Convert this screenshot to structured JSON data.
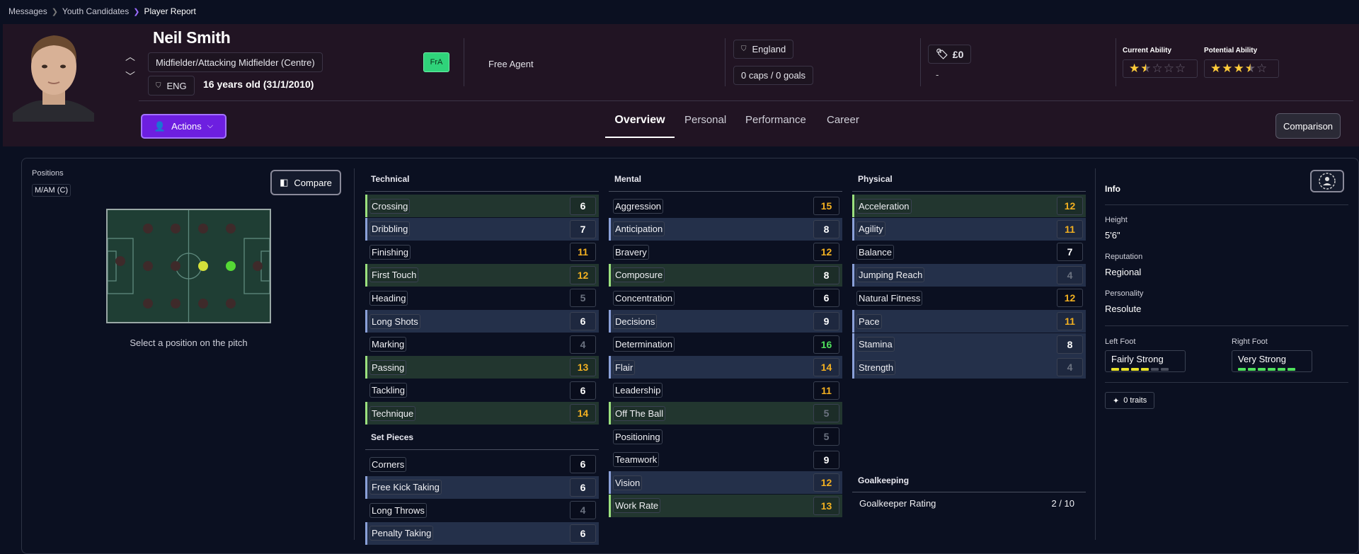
{
  "breadcrumb": {
    "items": [
      "Messages",
      "Youth Candidates",
      "Player Report"
    ]
  },
  "player": {
    "name": "Neil Smith",
    "role": "Midfielder/Attacking Midfielder (Centre)",
    "nation_code": "ENG",
    "age": "16 years old (31/1/2010)",
    "contract_badge": "FrA",
    "contract_status": "Free Agent",
    "nation": "England",
    "caps_goals": "0 caps / 0 goals",
    "value": "£0",
    "wage": "-",
    "current_ability_label": "Current Ability",
    "potential_ability_label": "Potential Ability",
    "current_ability_stars": 1.5,
    "potential_ability_stars": 3.5
  },
  "actions_label": "Actions",
  "tabs": [
    "Overview",
    "Personal",
    "Performance",
    "Career"
  ],
  "active_tab": "Overview",
  "comparison_label": "Comparison",
  "positions": {
    "label": "Positions",
    "tag": "M/AM (C)",
    "compare_label": "Compare",
    "hint": "Select a position on the pitch"
  },
  "technical": {
    "title": "Technical",
    "rows": [
      {
        "name": "Crossing",
        "value": "6"
      },
      {
        "name": "Dribbling",
        "value": "7"
      },
      {
        "name": "Finishing",
        "value": "11"
      },
      {
        "name": "First Touch",
        "value": "12"
      },
      {
        "name": "Heading",
        "value": "5"
      },
      {
        "name": "Long Shots",
        "value": "6"
      },
      {
        "name": "Marking",
        "value": "4"
      },
      {
        "name": "Passing",
        "value": "13"
      },
      {
        "name": "Tackling",
        "value": "6"
      },
      {
        "name": "Technique",
        "value": "14"
      }
    ]
  },
  "set_pieces": {
    "title": "Set Pieces",
    "rows": [
      {
        "name": "Corners",
        "value": "6"
      },
      {
        "name": "Free Kick Taking",
        "value": "6"
      },
      {
        "name": "Long Throws",
        "value": "4"
      },
      {
        "name": "Penalty Taking",
        "value": "6"
      }
    ]
  },
  "mental": {
    "title": "Mental",
    "rows": [
      {
        "name": "Aggression",
        "value": "15"
      },
      {
        "name": "Anticipation",
        "value": "8"
      },
      {
        "name": "Bravery",
        "value": "12"
      },
      {
        "name": "Composure",
        "value": "8"
      },
      {
        "name": "Concentration",
        "value": "6"
      },
      {
        "name": "Decisions",
        "value": "9"
      },
      {
        "name": "Determination",
        "value": "16"
      },
      {
        "name": "Flair",
        "value": "14"
      },
      {
        "name": "Leadership",
        "value": "11"
      },
      {
        "name": "Off The Ball",
        "value": "5"
      },
      {
        "name": "Positioning",
        "value": "5"
      },
      {
        "name": "Teamwork",
        "value": "9"
      },
      {
        "name": "Vision",
        "value": "12"
      },
      {
        "name": "Work Rate",
        "value": "13"
      }
    ]
  },
  "physical": {
    "title": "Physical",
    "rows": [
      {
        "name": "Acceleration",
        "value": "12"
      },
      {
        "name": "Agility",
        "value": "11"
      },
      {
        "name": "Balance",
        "value": "7"
      },
      {
        "name": "Jumping Reach",
        "value": "4"
      },
      {
        "name": "Natural Fitness",
        "value": "12"
      },
      {
        "name": "Pace",
        "value": "11"
      },
      {
        "name": "Stamina",
        "value": "8"
      },
      {
        "name": "Strength",
        "value": "4"
      }
    ]
  },
  "goalkeeping": {
    "title": "Goalkeeping",
    "label": "Goalkeeper Rating",
    "value": "2 / 10"
  },
  "info": {
    "title": "Info",
    "height_label": "Height",
    "height": "5'6\"",
    "reputation_label": "Reputation",
    "reputation": "Regional",
    "personality_label": "Personality",
    "personality": "Resolute",
    "left_foot_label": "Left Foot",
    "left_foot": "Fairly Strong",
    "right_foot_label": "Right Foot",
    "right_foot": "Very Strong",
    "traits": "0 traits"
  },
  "colors": {
    "accent": "#6d1fe0",
    "high": "#f2b021",
    "top": "#4fe05c",
    "low": "#6b7280"
  }
}
